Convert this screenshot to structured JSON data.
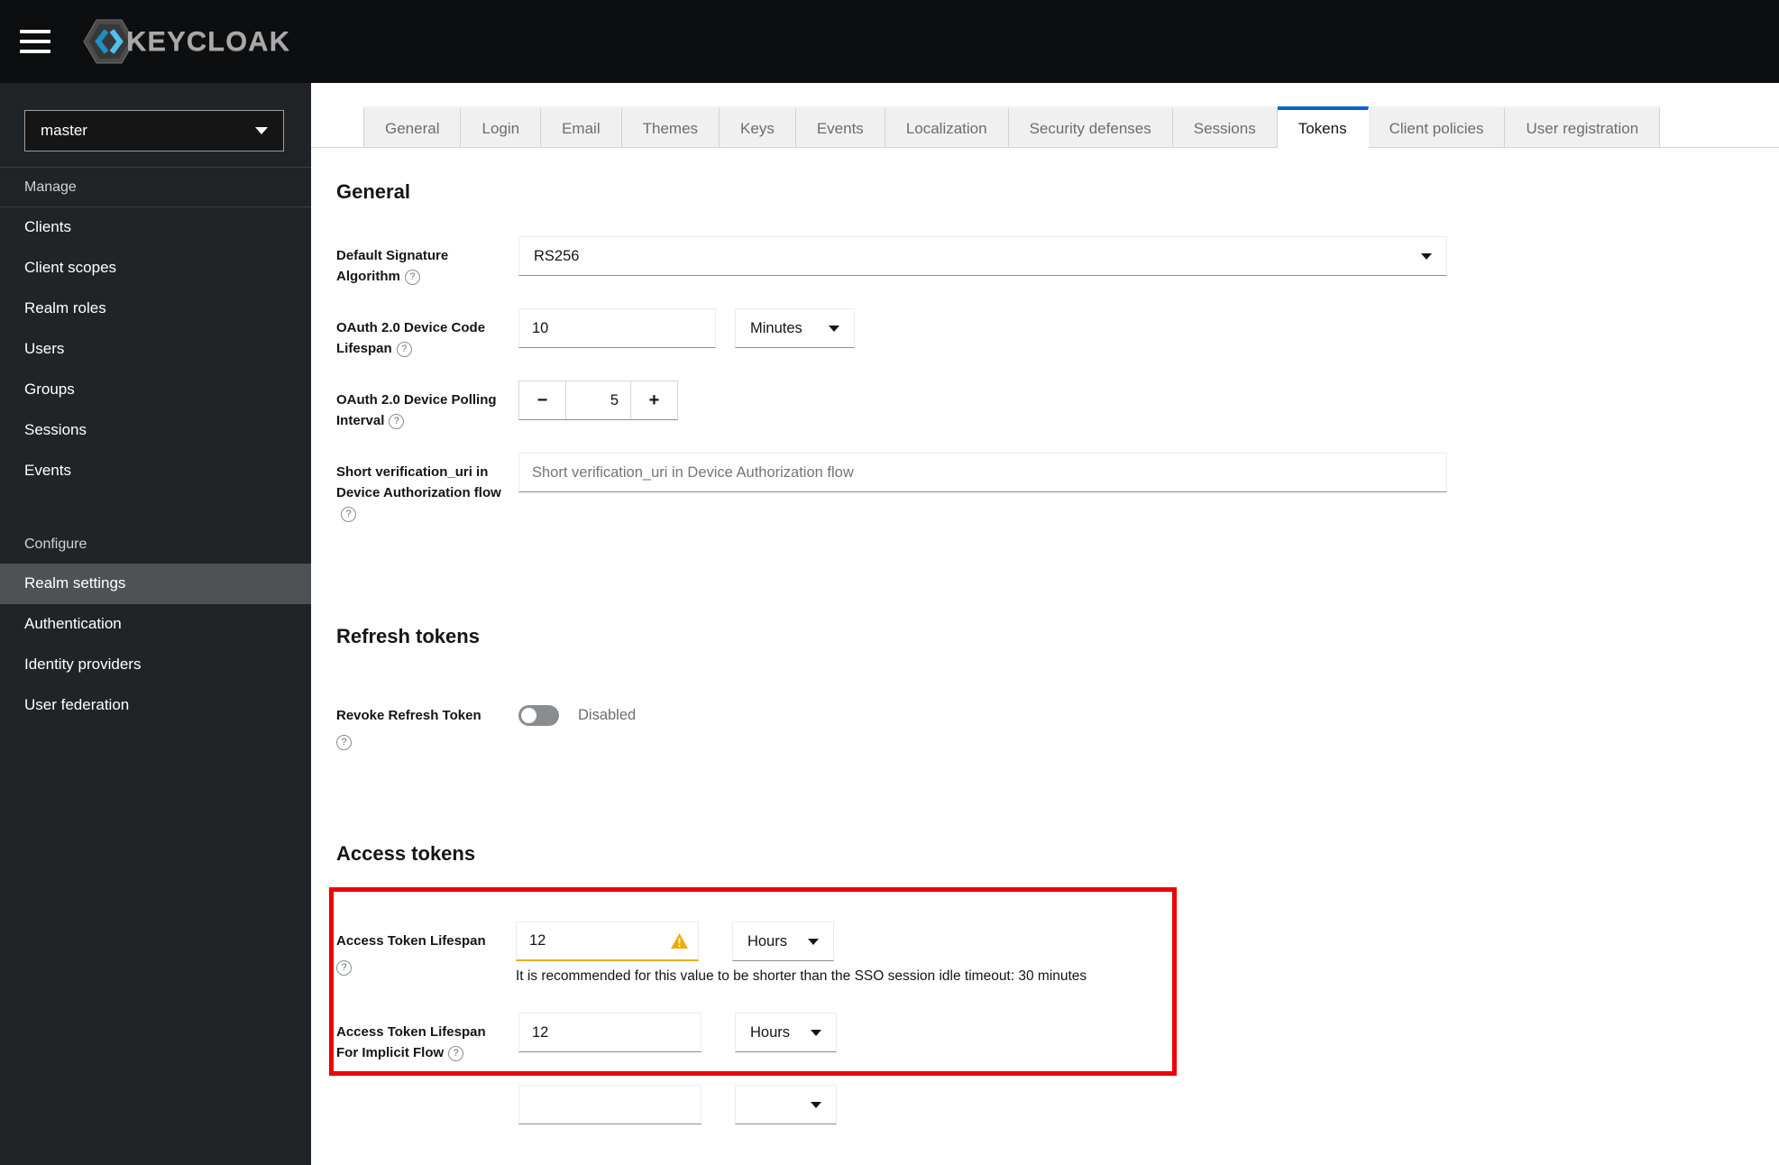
{
  "colors": {
    "accent": "#0066cc",
    "warning": "#f0ab00",
    "annotation": "#ee0000",
    "masthead_bg": "#0d0e10",
    "sidebar_bg": "#212427",
    "selected_nav": "#4f5255"
  },
  "masthead": {
    "brand": "KEYCLOAK"
  },
  "sidebar": {
    "realm": "master",
    "manage": {
      "label": "Manage",
      "items": [
        "Clients",
        "Client scopes",
        "Realm roles",
        "Users",
        "Groups",
        "Sessions",
        "Events"
      ]
    },
    "configure": {
      "label": "Configure",
      "items": [
        "Realm settings",
        "Authentication",
        "Identity providers",
        "User federation"
      ],
      "selected": "Realm settings"
    }
  },
  "tabs": [
    "General",
    "Login",
    "Email",
    "Themes",
    "Keys",
    "Events",
    "Localization",
    "Security defenses",
    "Sessions",
    "Tokens",
    "Client policies",
    "User registration"
  ],
  "active_tab": "Tokens",
  "form": {
    "general": {
      "title": "General",
      "default_signature": {
        "label": "Default Signature Algorithm",
        "value": "RS256"
      },
      "device_code_lifespan": {
        "label": "OAuth 2.0 Device Code Lifespan",
        "value": "10",
        "unit": "Minutes"
      },
      "device_polling": {
        "label": "OAuth 2.0 Device Polling Interval",
        "value": "5",
        "minus": "−",
        "plus": "+"
      },
      "short_verification": {
        "label": "Short verification_uri in Device Authorization flow",
        "placeholder": "Short verification_uri in Device Authorization flow"
      }
    },
    "refresh": {
      "title": "Refresh tokens",
      "revoke": {
        "label": "Revoke Refresh Token",
        "state": "Disabled"
      }
    },
    "access": {
      "title": "Access tokens",
      "lifespan": {
        "label": "Access Token Lifespan",
        "value": "12",
        "unit": "Hours",
        "warning": "It is recommended for this value to be shorter than the SSO session idle timeout: 30 minutes"
      },
      "implicit": {
        "label": "Access Token Lifespan For Implicit Flow",
        "value": "12",
        "unit": "Hours"
      }
    }
  }
}
